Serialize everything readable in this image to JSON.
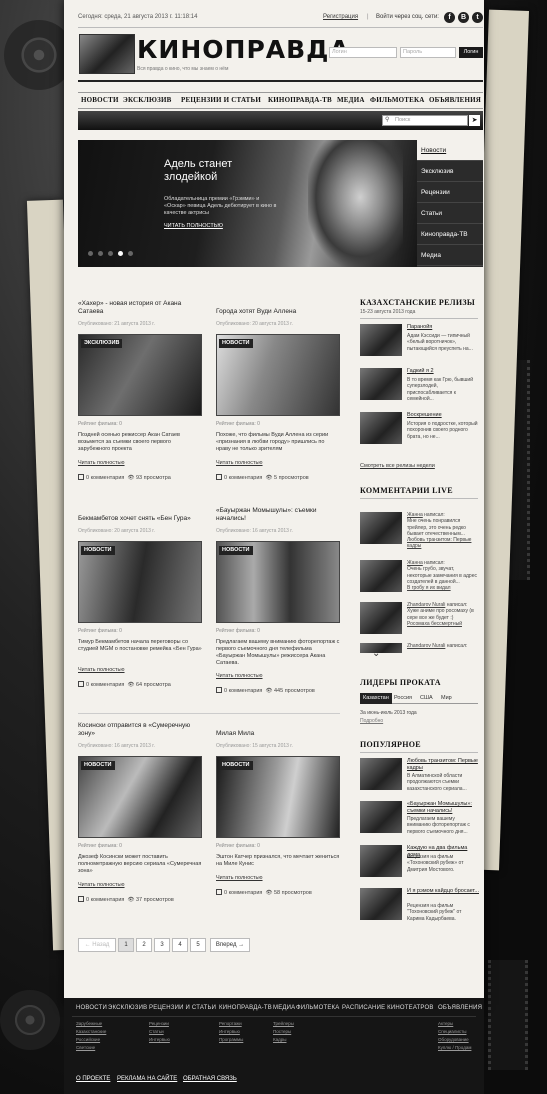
{
  "topbar": {
    "date": "Сегодня: среда, 21 августа 2013 г. 11:18:14",
    "register": "Регистрация",
    "sep": "|",
    "login_via": "Войти через соц. сети:",
    "social": [
      "f",
      "В",
      "t"
    ]
  },
  "header": {
    "logo": "КИНОПРАВДА",
    "tagline": "Вся правда о кино, что мы знаем о нём",
    "login_placeholder": "Логин",
    "password_placeholder": "Пароль",
    "login_button": "Логин"
  },
  "nav": [
    "НОВОСТИ",
    "ЭКСКЛЮЗИВ",
    "РЕЦЕНЗИИ И СТАТЬИ",
    "КИНОПРАВДА-ТВ",
    "МЕДИА",
    "ФИЛЬМОТЕКА",
    "ОБЪЯВЛЕНИЯ"
  ],
  "search": {
    "placeholder": "Поиск"
  },
  "slider": {
    "title": "Адель станет злодейкой",
    "text": "Обладательница премии «Грэмми» и «Оскар» певица Адель дебютирует в кино в качестве актрисы",
    "more": "ЧИТАТЬ ПОЛНОСТЬЮ",
    "active_dot": 3,
    "menu": [
      "Новости",
      "Эксклюзив",
      "Рецензии",
      "Статьи",
      "Кинoправда-ТВ",
      "Медиа"
    ]
  },
  "cards": [
    {
      "title": "«Хахер» - новая история от Акана Сатаева",
      "date": "Опубликовано: 21 августа 2013 г.",
      "tag": "ЭКСКЛЮЗИВ",
      "rating": "Рейтинг фильма: 0",
      "text": "Поздней осенью режиссер Акан Сатаев возьмется за съемки своего первого зарубежного проекта",
      "more": "Читать полностью",
      "comments": "0 комментария",
      "views": "93 просмотра"
    },
    {
      "title": "Города хотят Вуди Аллена",
      "date": "Опубликовано: 20 августа 2013 г.",
      "tag": "НОВОСТИ",
      "rating": "Рейтинг фильма: 0",
      "text": "Похоже, что фильмы Вуди Аллена из серии «признания в любви городу» пришлись по нраву не только зрителям",
      "more": "Читать полностью",
      "comments": "0 комментария",
      "views": "5 просмотров"
    },
    {
      "title": "Бекмамбетов хочет снять «Бен Гура»",
      "date": "Опубликовано: 20 августа 2013 г.",
      "tag": "НОВОСТИ",
      "rating": "Рейтинг фильма: 0",
      "text": "Тимур Бекмамбетов начала переговоры со студией MGM о постановке ремейка «Бен Гура»",
      "more": "Читать полностью",
      "comments": "0 комментария",
      "views": "64 просмотра"
    },
    {
      "title": "«Бауыржан Момышулы»: съемки начались!",
      "date": "Опубликовано: 16 августа 2013 г.",
      "tag": "НОВОСТИ",
      "rating": "Рейтинг фильма: 0",
      "text": "Предлагаем вашему вниманию фоторепортаж с первого съемочного дня телефильма «Бауыржан Момышулы» режиссера Акана Сатаева.",
      "more": "Читать полностью",
      "comments": "0 комментария",
      "views": "445 просмотров"
    },
    {
      "title": "Косински отправится в «Сумеречную зону»",
      "date": "Опубликовано: 16 августа 2013 г.",
      "tag": "НОВОСТИ",
      "rating": "Рейтинг фильма: 0",
      "text": "Джозеф Косински может поставить полнометражную версию сериала «Сумеречная зона»",
      "more": "Читать полностью",
      "comments": "0 комментария",
      "views": "37 просмотров"
    },
    {
      "title": "Милая Мила",
      "date": "Опубликовано: 15 августа 2013 г.",
      "tag": "НОВОСТИ",
      "rating": "Рейтинг фильма: 0",
      "text": "Эштон Катчер признался, что мечтает жениться на Миле Кунис",
      "more": "Читать полностью",
      "comments": "0 комментария",
      "views": "58 просмотров"
    }
  ],
  "sidebar": {
    "releases_title": "КАЗАХСТАНСКИЕ РЕЛИЗЫ",
    "releases_dates": "15-23 августа 2013 года",
    "releases": [
      {
        "title": "Паранойя",
        "text": "Адам Кэссиди — типичный «белый воротничок», пытающийся преуспеть на..."
      },
      {
        "title": "Гадкий я 2",
        "text": "В то время как Грю, бывший суперзлодей, приспосабливается к семейной..."
      },
      {
        "title": "Воскрешение",
        "text": "История о подростке, который похоронив своего родного брата, но не..."
      }
    ],
    "releases_more": "Смотреть все релизы недели",
    "comments_title": "КОММЕНТАРИИ LIVE",
    "comments": [
      {
        "author": "Жанна",
        "wrote": "написал:",
        "text": "Мне очень понравился трейлер, это очень редко бывает отечественным...",
        "link": "Любовь транзитом: Первые кадры"
      },
      {
        "author": "Жанна",
        "wrote": "написал:",
        "text": "Очень грубо, звучат, некоторые замечания в адрес создателей в данной...",
        "link": "В гробу я их видал"
      },
      {
        "author": "Zhandarov Nurali",
        "wrote": "написал:",
        "text": "Хуже аниме про росомаху (в сере все же будет :)",
        "link": "Росомаха бессмертный"
      },
      {
        "author": "Zhandarov Nurali",
        "wrote": "написал:",
        "text": "",
        "link": ""
      }
    ],
    "leaders_title": "ЛИДЕРЫ ПРОКАТА",
    "leaders_tabs": [
      "Казахстан",
      "Россия",
      "США",
      "Мир"
    ],
    "leaders_period": "За июнь-июль 2013 года",
    "leaders_more": "Подробно",
    "popular_title": "ПОПУЛЯРНОЕ",
    "popular": [
      {
        "title": "Любовь транзитом: Первые кадры",
        "text": "В Алматинской области продолжаются съемки казахстанского сериала..."
      },
      {
        "title": "«Бауыржан Момышулы»: съемки начались!",
        "text": "Предлагаем вашему вниманию фоторепортаж с первого съемочного дня..."
      },
      {
        "title": "Каждую на два фильма домa",
        "text": "Рецензия на фильм «Тохоновский рубеж» от Дмитрия Мостового."
      },
      {
        "title": "И я рэмом кайдцо бросает...",
        "text": "Рецензия на фильм \"Тохоновский рубеж\" от Карима Кадырбаева."
      }
    ]
  },
  "pagination": {
    "prev": "← Назад",
    "pages": [
      "1",
      "2",
      "3",
      "4",
      "5"
    ],
    "current": "1",
    "next": "Вперед →"
  },
  "footer": {
    "nav": [
      "НОВОСТИ",
      "ЭКСКЛЮЗИВ",
      "РЕЦЕНЗИИ И СТАТЬИ",
      "КИНОПРАВДА-ТВ",
      "МЕДИА",
      "ФИЛЬМОТЕКА",
      "РАСПИСАНИЕ КИНОТЕАТРОВ",
      "ОБЪЯВЛЕНИЯ"
    ],
    "col1": [
      "Зарубежные",
      "Казахстанские",
      "Российские",
      "Светские"
    ],
    "col2": [
      "Рецензии",
      "Статьи",
      "Интервью"
    ],
    "col3": [
      "Репортажи",
      "Интервью",
      "Программы"
    ],
    "col4": [
      "Трейлеры",
      "Постеры",
      "Кадры"
    ],
    "col5": [
      "Актеры",
      "Специалисты",
      "Оборудование",
      "Куплю / Продам"
    ],
    "bottom": [
      "О ПРОЕКТЕ",
      "РЕКЛАМА НА САЙТЕ",
      "ОБРАТНАЯ СВЯЗЬ"
    ]
  }
}
